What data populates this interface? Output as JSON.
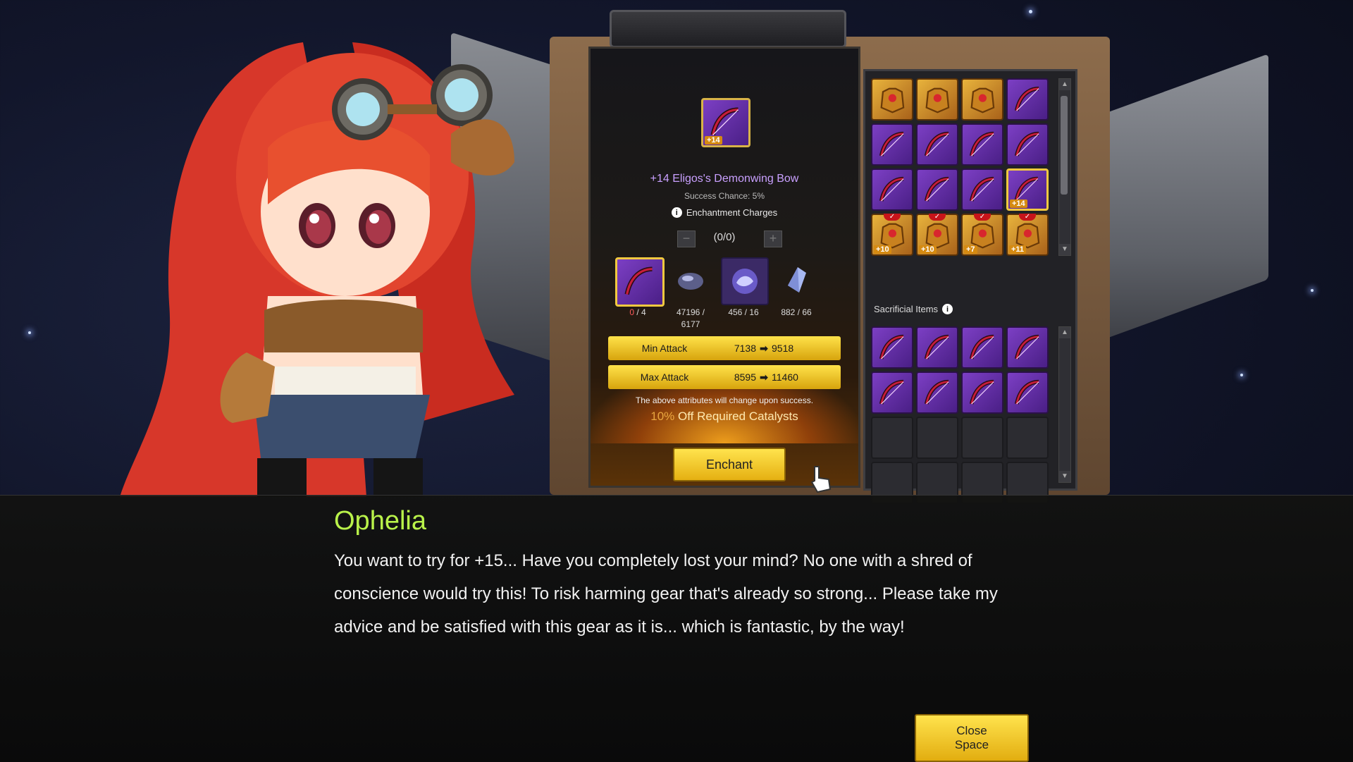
{
  "character": {
    "name": "Ophelia"
  },
  "enchant_panel": {
    "target_item": {
      "name": "+14 Eligos's Demonwing Bow",
      "enhancement_tag": "+14"
    },
    "success_chance": "Success Chance: 5%",
    "charges_label": "Enchantment Charges",
    "charges_value": "(0/0)",
    "catalysts": [
      {
        "icon": "bow-icon",
        "count": "0",
        "required": " / 4"
      },
      {
        "icon": "onyx-stone-icon",
        "count": "47196 /",
        "required": "6177"
      },
      {
        "icon": "crystal-fragment-icon",
        "count": "456 / 16",
        "required": ""
      },
      {
        "icon": "chaos-crystal-icon",
        "count": "882 / 66",
        "required": ""
      }
    ],
    "stats": [
      {
        "label": "Min Attack",
        "from": "7138",
        "to": "9518"
      },
      {
        "label": "Max Attack",
        "from": "8595",
        "to": "11460"
      }
    ],
    "note": "The above attributes will change upon success.",
    "discount_pct": "10%",
    "discount_text": " Off Required Catalysts",
    "enchant_label": "Enchant"
  },
  "inventory": {
    "items": [
      {
        "type": "gold",
        "tag": "",
        "checked": false,
        "selected": false
      },
      {
        "type": "gold",
        "tag": "",
        "checked": false,
        "selected": false
      },
      {
        "type": "gold",
        "tag": "",
        "checked": false,
        "selected": false
      },
      {
        "type": "purple",
        "tag": "",
        "checked": false,
        "selected": false
      },
      {
        "type": "purple",
        "tag": "",
        "checked": false,
        "selected": false
      },
      {
        "type": "purple",
        "tag": "",
        "checked": false,
        "selected": false
      },
      {
        "type": "purple",
        "tag": "",
        "checked": false,
        "selected": false
      },
      {
        "type": "purple",
        "tag": "",
        "checked": false,
        "selected": false
      },
      {
        "type": "purple",
        "tag": "",
        "checked": false,
        "selected": false
      },
      {
        "type": "purple",
        "tag": "",
        "checked": false,
        "selected": false
      },
      {
        "type": "purple",
        "tag": "",
        "checked": false,
        "selected": false
      },
      {
        "type": "purple",
        "tag": "+14",
        "checked": false,
        "selected": true
      },
      {
        "type": "gold",
        "tag": "+10",
        "checked": true,
        "selected": false
      },
      {
        "type": "gold",
        "tag": "+10",
        "checked": true,
        "selected": false
      },
      {
        "type": "gold",
        "tag": "+7",
        "checked": true,
        "selected": false
      },
      {
        "type": "gold",
        "tag": "+11",
        "checked": true,
        "selected": false
      }
    ]
  },
  "sacrificial": {
    "label": "Sacrificial Items",
    "items": [
      "purple",
      "purple",
      "purple",
      "purple",
      "purple",
      "purple",
      "purple",
      "purple",
      "empty",
      "empty",
      "empty",
      "empty",
      "empty",
      "empty",
      "empty",
      "empty"
    ]
  },
  "dialogue": {
    "speaker": "Ophelia",
    "text": "You want to try for +15... Have you completely lost your mind? No one with a shred of conscience would try this! To risk harming gear that's already so strong... Please take my advice and be satisfied with this gear as it is... which is fantastic, by the way!"
  },
  "close_button": {
    "line1": "Close",
    "line2": "Space"
  },
  "colors": {
    "accent_yellow": "#ffe34d",
    "speaker_green": "#b9f24a",
    "item_name_purple": "#c9a0ff"
  }
}
